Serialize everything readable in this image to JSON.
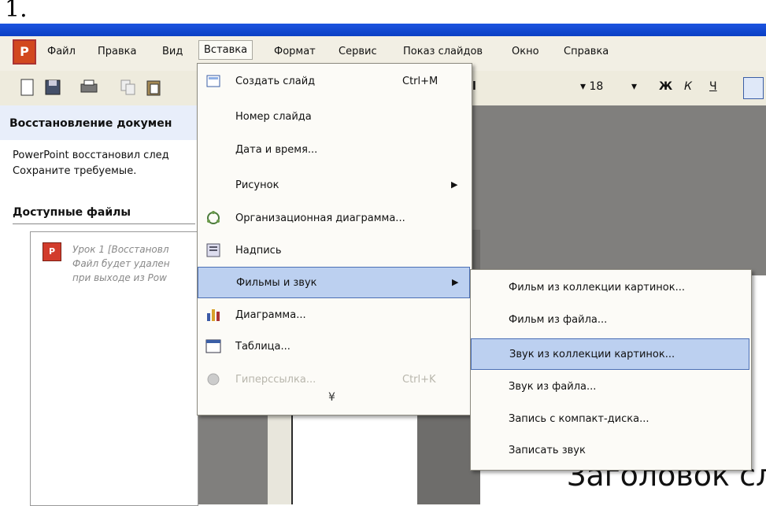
{
  "figure_number": "1.",
  "menubar": {
    "items": [
      "Файл",
      "Правка",
      "Вид",
      "Вставка",
      "Формат",
      "Сервис",
      "Показ слайдов",
      "Окно",
      "Справка"
    ]
  },
  "format_bar": {
    "font_size": "18",
    "bold": "Ж",
    "italic": "К",
    "underline": "Ч"
  },
  "task_pane": {
    "title": "Восстановление докумен",
    "text_line1": "PowerPoint восстановил след",
    "text_line2": "Сохраните требуемые.",
    "available_files": "Доступные файлы",
    "file_line1": "Урок 1  [Восстановл",
    "file_line2": "Файл будет удален",
    "file_line3": "при выходе из Pow"
  },
  "insert_menu": {
    "items": [
      {
        "label": "Создать слайд",
        "shortcut": "Ctrl+M",
        "icon": "new-slide-icon"
      },
      {
        "label": "Номер слайда",
        "shortcut": "",
        "icon": ""
      },
      {
        "label": "Дата и время...",
        "shortcut": "",
        "icon": ""
      },
      {
        "label": "Рисунок",
        "shortcut": "",
        "icon": "",
        "submenu": true
      },
      {
        "label": "Организационная диаграмма...",
        "shortcut": "",
        "icon": "org-chart-icon"
      },
      {
        "label": "Надпись",
        "shortcut": "",
        "icon": "textbox-icon"
      },
      {
        "label": "Фильмы и звук",
        "shortcut": "",
        "icon": "",
        "submenu": true,
        "highlighted": true
      },
      {
        "label": "Диаграмма...",
        "shortcut": "",
        "icon": "chart-icon"
      },
      {
        "label": "Таблица...",
        "shortcut": "",
        "icon": "table-icon"
      },
      {
        "label": "Гиперссылка...",
        "shortcut": "Ctrl+K",
        "icon": "hyperlink-icon",
        "disabled": true
      }
    ],
    "expand_glyph": "¥"
  },
  "submenu": {
    "items": [
      {
        "label": "Фильм из коллекции картинок..."
      },
      {
        "label": "Фильм из файла..."
      },
      {
        "label": "Звук из коллекции картинок...",
        "highlighted": true
      },
      {
        "label": "Звук из файла..."
      },
      {
        "label": "Запись с компакт-диска..."
      },
      {
        "label": "Записать звук"
      }
    ]
  },
  "slide": {
    "title_text": "Заголовок сл"
  },
  "colors": {
    "highlight": "#bcd0f0",
    "highlight_border": "#4b6fb5",
    "titlebar": "#1c54e0"
  }
}
